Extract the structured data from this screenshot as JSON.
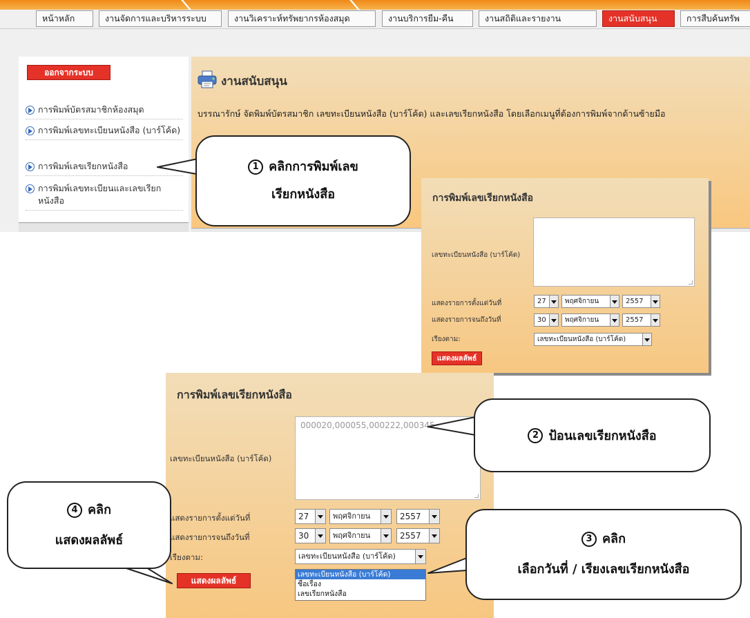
{
  "nav": {
    "tabs": [
      {
        "label": "หน้าหลัก"
      },
      {
        "label": "งานจัดการและบริหารระบบ"
      },
      {
        "label": "งานวิเคราะห์ทรัพยากรห้องสมุด"
      },
      {
        "label": "งานบริการยืม-คืน"
      },
      {
        "label": "งานสถิติและรายงาน"
      },
      {
        "label": "งานสนับสนุน",
        "active": true
      },
      {
        "label": "การสืบค้นทรัพ"
      }
    ]
  },
  "sidebar": {
    "logout_label": "ออกจากระบบ",
    "items": [
      {
        "label": "การพิมพ์บัตรสมาชิกห้องสมุด"
      },
      {
        "label": "การพิมพ์เลขทะเบียนหนังสือ (บาร์โค้ด)"
      },
      {
        "label": "การพิมพ์เลขเรียกหนังสือ"
      },
      {
        "label": "การพิมพ์เลขทะเบียนและเลขเรียกหนังสือ"
      }
    ]
  },
  "main": {
    "title": "งานสนับสนุน",
    "description": "บรรณารักษ์ จัดพิมพ์บัตรสมาชิก เลขทะเบียนหนังสือ (บาร์โค้ด) และเลขเรียกหนังสือ โดยเลือกเมนูที่ต้องการพิมพ์จากด้านซ้ายมือ"
  },
  "callouts": {
    "c1": {
      "num": "1",
      "line1": "คลิกการพิมพ์เลข",
      "line2": "เรียกหนังสือ"
    },
    "c2": {
      "num": "2",
      "text": "ป้อนเลขเรียกหนังสือ"
    },
    "c3": {
      "num": "3",
      "line1": "คลิก",
      "line2": "เลือกวันที่ / เรียงเลขเรียกหนังสือ"
    },
    "c4": {
      "num": "4",
      "line1": "คลิก",
      "line2": "แสดงผลลัพธ์"
    }
  },
  "form_small": {
    "title": "การพิมพ์เลขเรียกหนังสือ",
    "barcode_label": "เลขทะเบียนหนังสือ (บาร์โค้ด)",
    "barcode_value": "",
    "from_label": "แสดงรายการตั้งแต่วันที่",
    "to_label": "แสดงรายการจนถึงวันที่",
    "sort_label": "เรียงตาม:",
    "from_day": "27",
    "from_month": "พฤศจิกายน",
    "from_year": "2557",
    "to_day": "30",
    "to_month": "พฤศจิกายน",
    "to_year": "2557",
    "sort_value": "เลขทะเบียนหนังสือ (บาร์โค้ด)",
    "submit_label": "แสดงผลลัพธ์"
  },
  "form_large": {
    "title": "การพิมพ์เลขเรียกหนังสือ",
    "barcode_label": "เลขทะเบียนหนังสือ (บาร์โค้ด)",
    "barcode_value": "000020,000055,000222,000345",
    "from_label": "แสดงรายการตั้งแต่วันที่",
    "to_label": "แสดงรายการจนถึงวันที่",
    "sort_label": "เรียงตาม:",
    "from_day": "27",
    "from_month": "พฤศจิกายน",
    "from_year": "2557",
    "to_day": "30",
    "to_month": "พฤศจิกายน",
    "to_year": "2557",
    "sort_value": "เลขทะเบียนหนังสือ (บาร์โค้ด)",
    "submit_label": "แสดงผลลัพธ์",
    "sort_options": [
      {
        "label": "เลขทะเบียนหนังสือ (บาร์โค้ด)",
        "highlighted": true
      },
      {
        "label": "ชื่อเรื่อง"
      },
      {
        "label": "เลขเรียกหนังสือ"
      }
    ]
  },
  "colors": {
    "accent_red": "#e53228",
    "panel_orange": "#f7c781",
    "nav_orange": "#f08a18"
  }
}
